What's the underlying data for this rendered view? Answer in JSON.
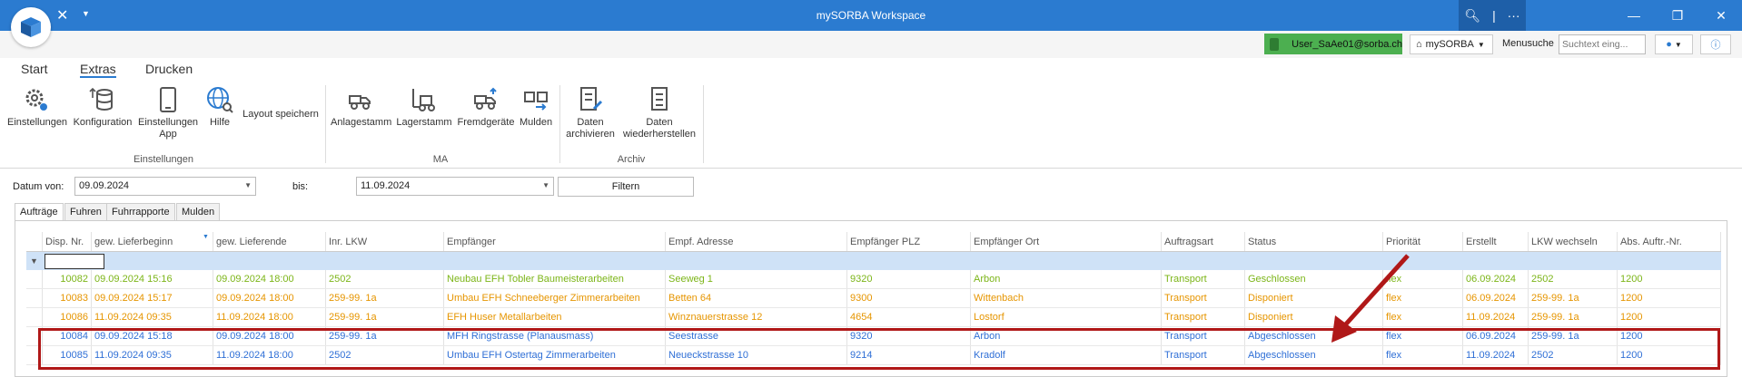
{
  "window": {
    "title": "mySORBA Workspace"
  },
  "userbar": {
    "user": "User_SaAe01@sorba.ch",
    "mysorba": "mySORBA",
    "menu_label": "Menusuche",
    "menu_placeholder": "Suchtext eing..."
  },
  "ribbon": {
    "tabs": [
      "Start",
      "Extras",
      "Drucken"
    ],
    "active_tab": "Extras",
    "groups": [
      {
        "label": "Einstellungen",
        "buttons": [
          "Einstellungen",
          "Konfiguration",
          "Einstellungen App",
          "Hilfe",
          "Layout speichern"
        ]
      },
      {
        "label": "MA",
        "buttons": [
          "Anlagestamm",
          "Lagerstamm",
          "Fremdgeräte",
          "Mulden"
        ]
      },
      {
        "label": "Archiv",
        "buttons": [
          "Daten archivieren",
          "Daten wiederherstellen"
        ]
      }
    ],
    "btn": {
      "einstellungen": "Einstellungen",
      "konfiguration": "Konfiguration",
      "einstellungen_app_1": "Einstellungen",
      "einstellungen_app_2": "App",
      "hilfe": "Hilfe",
      "layout": "Layout speichern",
      "anlagestamm": "Anlagestamm",
      "lagerstamm": "Lagerstamm",
      "fremdgeraete": "Fremdgeräte",
      "mulden": "Mulden",
      "archivieren_1": "Daten",
      "archivieren_2": "archivieren",
      "wiederherstellen_1": "Daten",
      "wiederherstellen_2": "wiederherstellen"
    },
    "group_labels": {
      "einstellungen": "Einstellungen",
      "ma": "MA",
      "archiv": "Archiv"
    }
  },
  "filter": {
    "datum_von_label": "Datum von:",
    "datum_von": "09.09.2024",
    "bis_label": "bis:",
    "bis": "11.09.2024",
    "button": "Filtern"
  },
  "grid_tabs": [
    "Aufträge",
    "Fuhren",
    "Fuhrrapporte",
    "Mulden"
  ],
  "grid": {
    "columns": [
      "Disp. Nr.",
      "gew. Lieferbeginn",
      "gew. Lieferende",
      "Inr. LKW",
      "Empfänger",
      "Empf. Adresse",
      "Empfänger PLZ",
      "Empfänger Ort",
      "Auftragsart",
      "Status",
      "Priorität",
      "Erstellt",
      "LKW wechseln",
      "Abs. Auftr.-Nr."
    ],
    "rows": [
      {
        "cells": [
          "10082",
          "09.09.2024 15:16",
          "09.09.2024 18:00",
          "2502",
          "Neubau EFH Tobler Baumeisterarbeiten",
          "Seeweg 1",
          "9320",
          "Arbon",
          "Transport",
          "Geschlossen",
          "flex",
          "06.09.2024",
          "2502",
          "1200"
        ],
        "color": "#7cb518"
      },
      {
        "cells": [
          "10083",
          "09.09.2024 15:17",
          "09.09.2024 18:00",
          "259-99. 1a",
          "Umbau EFH Schneeberger Zimmerarbeiten",
          "Betten 64",
          "9300",
          "Wittenbach",
          "Transport",
          "Disponiert",
          "flex",
          "06.09.2024",
          "259-99. 1a",
          "1200"
        ],
        "color": "#e69500"
      },
      {
        "cells": [
          "10086",
          "11.09.2024 09:35",
          "11.09.2024 18:00",
          "259-99. 1a",
          "EFH Huser Metallarbeiten",
          "Winznauerstrasse 12",
          "4654",
          "Lostorf",
          "Transport",
          "Disponiert",
          "flex",
          "11.09.2024",
          "259-99. 1a",
          "1200"
        ],
        "color": "#e69500"
      },
      {
        "cells": [
          "10084",
          "09.09.2024 15:18",
          "09.09.2024 18:00",
          "259-99. 1a",
          "MFH Ringstrasse (Planausmass)",
          "Seestrasse",
          "9320",
          "Arbon",
          "Transport",
          "Abgeschlossen",
          "flex",
          "06.09.2024",
          "259-99. 1a",
          "1200"
        ],
        "color": "#2f6fd6"
      },
      {
        "cells": [
          "10085",
          "11.09.2024 09:35",
          "11.09.2024 18:00",
          "2502",
          "Umbau EFH Ostertag Zimmerarbeiten",
          "Neueckstrasse 10",
          "9214",
          "Kradolf",
          "Transport",
          "Abgeschlossen",
          "flex",
          "11.09.2024",
          "2502",
          "1200"
        ],
        "color": "#2f6fd6"
      }
    ]
  },
  "colors": {
    "titlebar": "#2b7bd0",
    "user_badge": "#4caf50",
    "highlight": "#b01818",
    "filter_row": "#cfe2f7"
  }
}
